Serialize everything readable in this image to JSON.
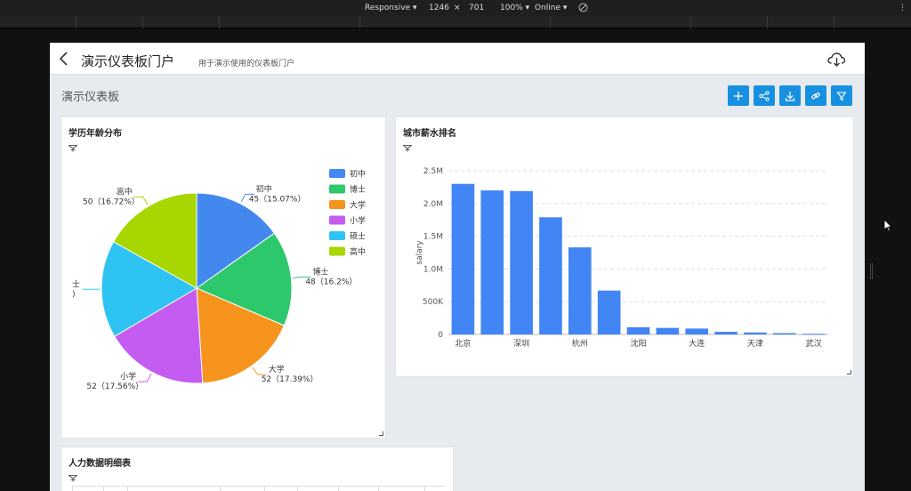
{
  "devtools": {
    "device": "Responsive ▾",
    "width": "1246",
    "x": "×",
    "height": "701",
    "zoom": "100% ▾",
    "network": "Online ▾",
    "more": "⋮"
  },
  "header": {
    "title": "演示仪表板门户",
    "subtitle": "用于演示使用的仪表板门户"
  },
  "dashboard": {
    "title": "演示仪表板"
  },
  "cards": {
    "pie_title": "学历年龄分布",
    "bar_title": "城市薪水排名",
    "table_title": "人力数据明细表"
  },
  "colors": {
    "accent": "#1890e0",
    "bar": "#4285f4"
  },
  "chart_data": [
    {
      "type": "pie",
      "title": "学历年龄分布",
      "slices": [
        {
          "name": "初中",
          "value": 45,
          "label": "45（15.07%）",
          "color": "#4388ee"
        },
        {
          "name": "博士",
          "value": 48,
          "label": "48（16.2%）",
          "color": "#2ec86c"
        },
        {
          "name": "大学",
          "value": 52,
          "label": "52（17.39%）",
          "color": "#f7941d"
        },
        {
          "name": "小学",
          "value": 52,
          "label": "52（17.56%）",
          "color": "#c55cf2"
        },
        {
          "name": "硕士",
          "value": 49,
          "label": "",
          "color": "#2ec3f2"
        },
        {
          "name": "高中",
          "value": 50,
          "label": "50（16.72%）",
          "color": "#a8d600"
        }
      ],
      "clipped_label": [
        "士",
        ")"
      ],
      "legend": "right"
    },
    {
      "type": "bar",
      "title": "城市薪水排名",
      "ylabel": "salary",
      "ylim": [
        0,
        2500000
      ],
      "yticks": [
        "0",
        "500K",
        "1.0M",
        "1.5M",
        "2.0M",
        "2.5M"
      ],
      "categories": [
        "北京",
        "",
        "深圳",
        "",
        "杭州",
        "",
        "沈阳",
        "",
        "大连",
        "",
        "天津",
        "",
        "武汉"
      ],
      "values": [
        2300000,
        2200000,
        2190000,
        1790000,
        1330000,
        670000,
        110000,
        100000,
        90000,
        40000,
        30000,
        20000,
        10000
      ],
      "grid": true
    }
  ]
}
